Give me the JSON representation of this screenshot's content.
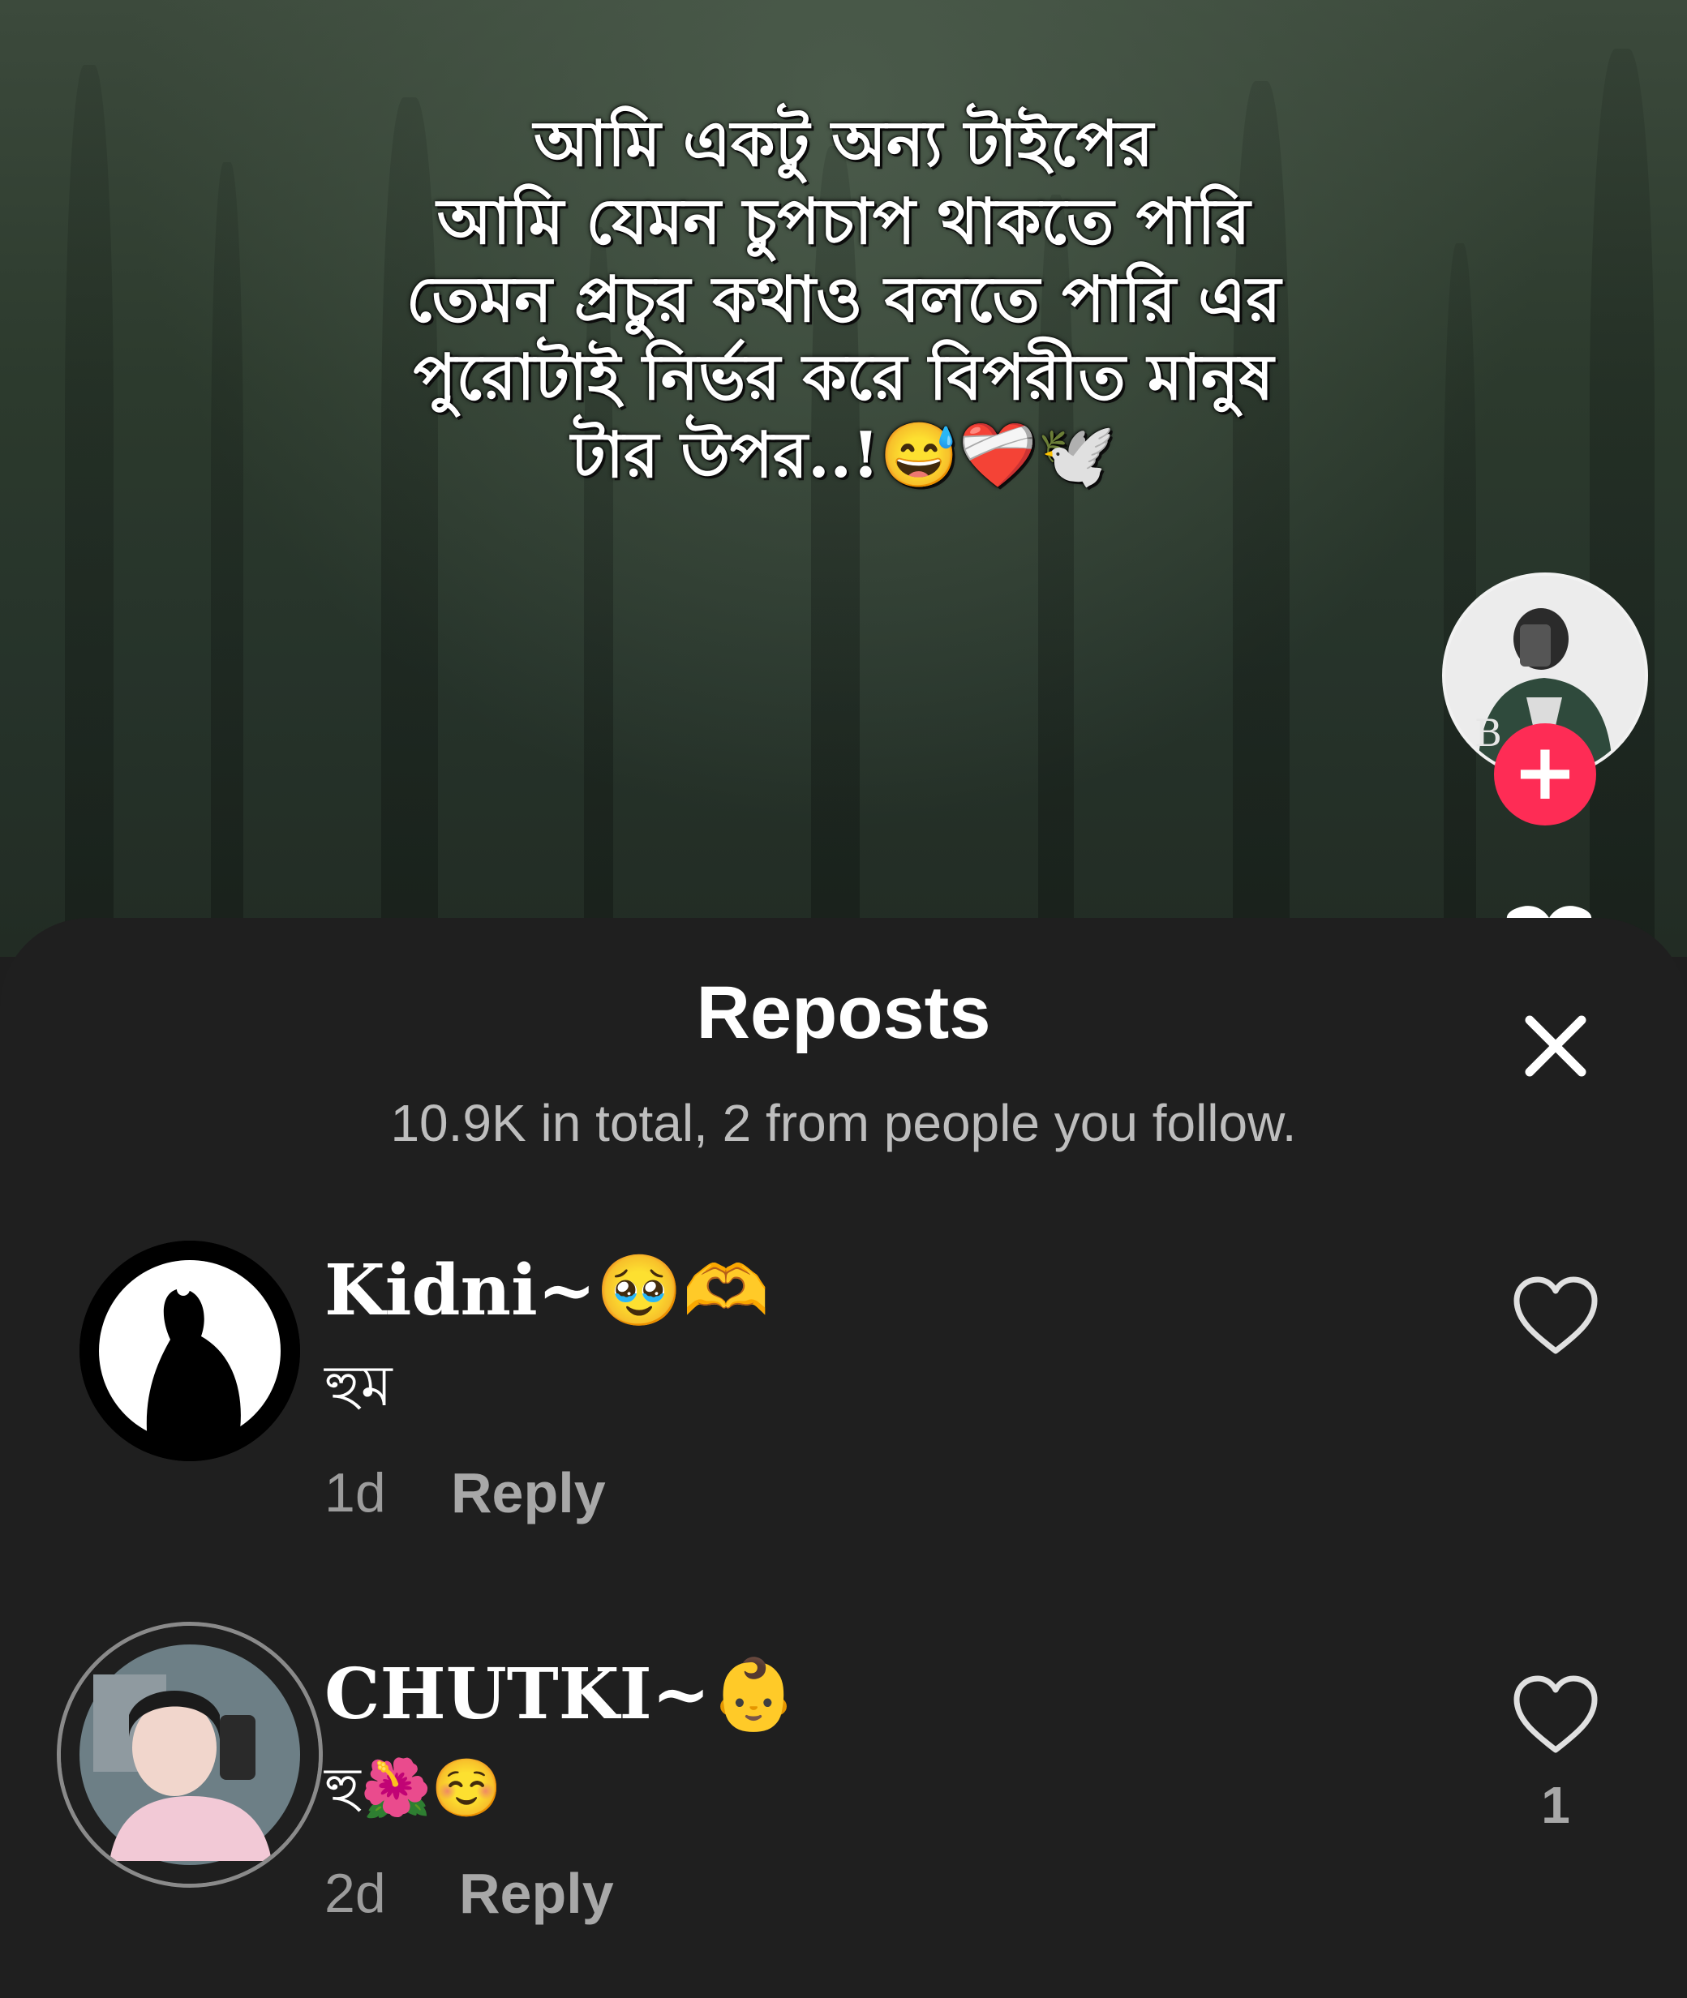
{
  "video": {
    "caption": "আমি একটু অন্য টাইপের\nআমি যেমন চুপচাপ থাকতে পারি\nতেমন প্রচুর কথাও বলতে পারি এর\nপুরোটাই নির্ভর করে বিপরীত মানুষ\nটার উপর..!😅❤️‍🩹🕊️",
    "follow_label": "+",
    "creator_avatar_icon": "person-photo-icon"
  },
  "sheet": {
    "title": "Reposts",
    "subtitle": "10.9K in total, 2 from people you follow.",
    "close_icon": "close-icon"
  },
  "comments": [
    {
      "username": "Kidni~🥹🫶",
      "text": "হুম",
      "time": "1d",
      "reply_label": "Reply",
      "like_count": ""
    },
    {
      "username": "CHUTKI~👶",
      "text": "হু🌺☺️",
      "time": "2d",
      "reply_label": "Reply",
      "like_count": "1"
    }
  ],
  "colors": {
    "accent": "#fe2c55",
    "sheet_bg": "#1f1f1f",
    "secondary_text": "#9c9c9c"
  }
}
